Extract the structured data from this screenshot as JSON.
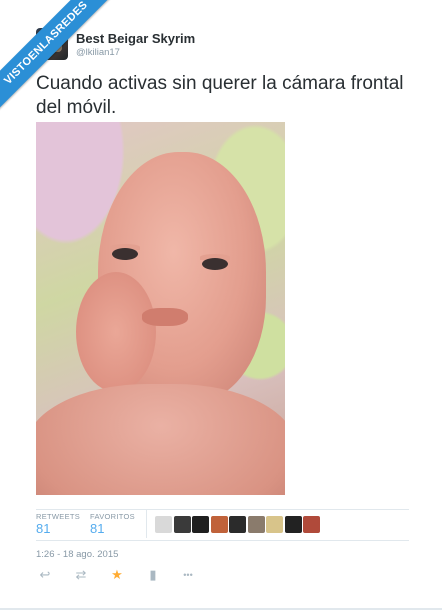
{
  "watermark": {
    "text": "VISTOENLASREDES"
  },
  "tweet": {
    "author_name": "Best Beigar Skyrim",
    "author_handle": "@lkilian17",
    "text": "Cuando activas sin querer la cámara frontal del móvil.",
    "timestamp": "1:26 - 18 ago. 2015"
  },
  "stats": {
    "retweets_label": "RETWEETS",
    "retweets_count": "81",
    "favorites_label": "FAVORITOS",
    "favorites_count": "81"
  },
  "favoriters": [
    {
      "color": "#d9d9d9"
    },
    {
      "color": "#3a3a3a"
    },
    {
      "color": "#1f1f1f"
    },
    {
      "color": "#c0623a"
    },
    {
      "color": "#2b2b2b"
    },
    {
      "color": "#8a7b6c"
    },
    {
      "color": "#d8c48a"
    },
    {
      "color": "#222222"
    },
    {
      "color": "#b04a3a"
    }
  ],
  "actions": [
    {
      "name": "reply-icon",
      "glyph": "↩"
    },
    {
      "name": "retweet-icon",
      "glyph": "⇄"
    },
    {
      "name": "favorite-icon",
      "glyph": "★"
    },
    {
      "name": "stats-icon",
      "glyph": "▮"
    },
    {
      "name": "more-icon",
      "glyph": "•••"
    }
  ],
  "colors": {
    "link": "#55acee",
    "favorite_active": "#ffac33",
    "muted": "#8899a6",
    "ribbon": "#2b8fd6"
  }
}
